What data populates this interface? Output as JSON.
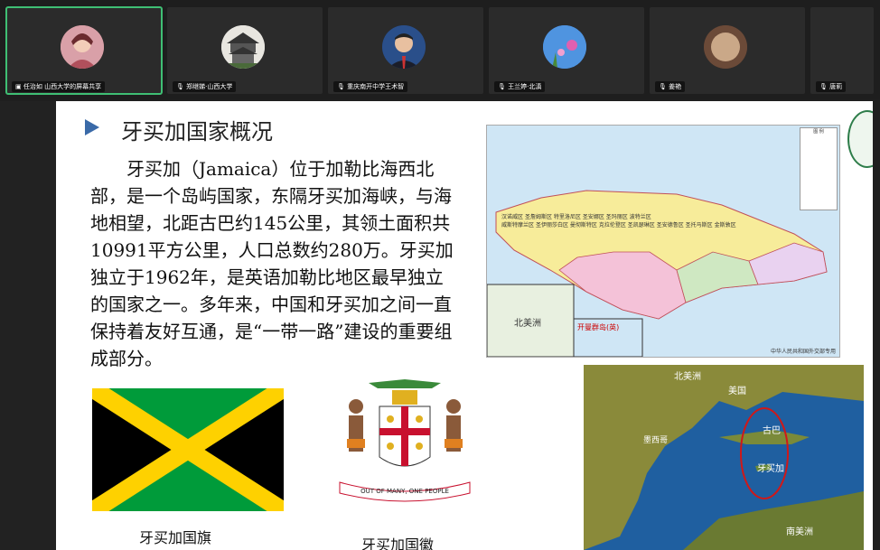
{
  "participants": [
    {
      "name": "任治如 山西大学的屏幕共享",
      "active": true
    },
    {
      "name": "郑继娣·山西大学",
      "active": false
    },
    {
      "name": "重庆南开中学王术智",
      "active": false
    },
    {
      "name": "王兰婷·北滇",
      "active": false
    },
    {
      "name": "姜艳",
      "active": false
    },
    {
      "name": "唐莉",
      "active": false
    }
  ],
  "slide": {
    "title": "牙买加国家概况",
    "body": "牙买加（Jamaica）位于加勒比海西北部，是一个岛屿国家，东隔牙买加海峡，与海地相望，北距古巴约145公里，其领土面积共10991平方公里，人口总数约280万。牙买加独立于1962年，是英语加勒比地区最早独立的国家之一。多年来，中国和牙买加之间一直保持着友好互通，是“一带一路”建设的重要组成部分。",
    "flag_caption": "牙买加国旗",
    "emblem_caption": "牙买加国徽",
    "emblem_motto": "OUT OF MANY, ONE PEOPLE",
    "map": {
      "inset_label": "北美洲",
      "cayman_label": "开曼群岛(英)",
      "legend_title": "图 例",
      "footer": "中华人民共和国外交部专用",
      "parishes": [
        "汉诺威区",
        "圣詹姆斯区",
        "特里洛尼区",
        "圣安娜区",
        "圣玛丽区",
        "波特兰区",
        "威斯特摩兰区",
        "圣伊丽莎白区",
        "曼彻斯特区",
        "克拉伦登区",
        "圣凯瑟琳区",
        "圣安德鲁区",
        "圣托马斯区",
        "金斯敦区"
      ]
    },
    "region": {
      "north_america": "北美洲",
      "usa": "美国",
      "cuba": "古巴",
      "mexico": "墨西哥",
      "jamaica": "牙买加",
      "south_america": "南美洲"
    }
  }
}
